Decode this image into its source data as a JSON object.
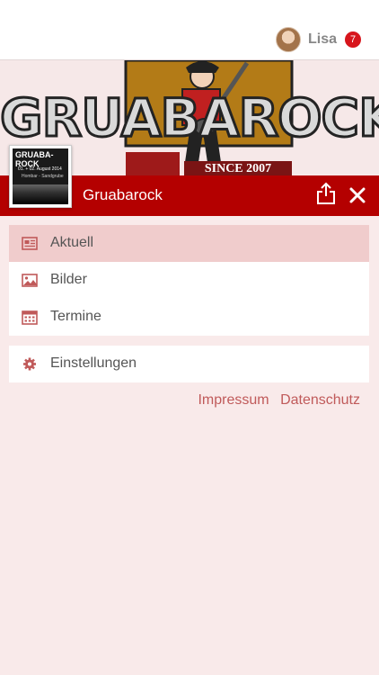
{
  "user": {
    "name": "Lisa",
    "notifications": "7"
  },
  "banner": {
    "logo_text": "GRUABAROCK",
    "since_text": "SINCE 2007"
  },
  "thumbnail": {
    "title": "GRUABA-ROCK",
    "line1": "01. + 02. August 2014",
    "line2": "Hombar - Sandgrube"
  },
  "header": {
    "title": "Gruabarock"
  },
  "menu": [
    {
      "label": "Aktuell",
      "icon": "newspaper-icon",
      "active": true
    },
    {
      "label": "Bilder",
      "icon": "image-icon",
      "active": false
    },
    {
      "label": "Termine",
      "icon": "calendar-icon",
      "active": false
    }
  ],
  "settings": {
    "label": "Einstellungen",
    "icon": "gear-icon"
  },
  "footer": {
    "impressum": "Impressum",
    "datenschutz": "Datenschutz"
  },
  "colors": {
    "accent": "#b40000",
    "icon": "#c05a5a",
    "background": "#f9eaea",
    "active_row": "#f0cccc"
  }
}
